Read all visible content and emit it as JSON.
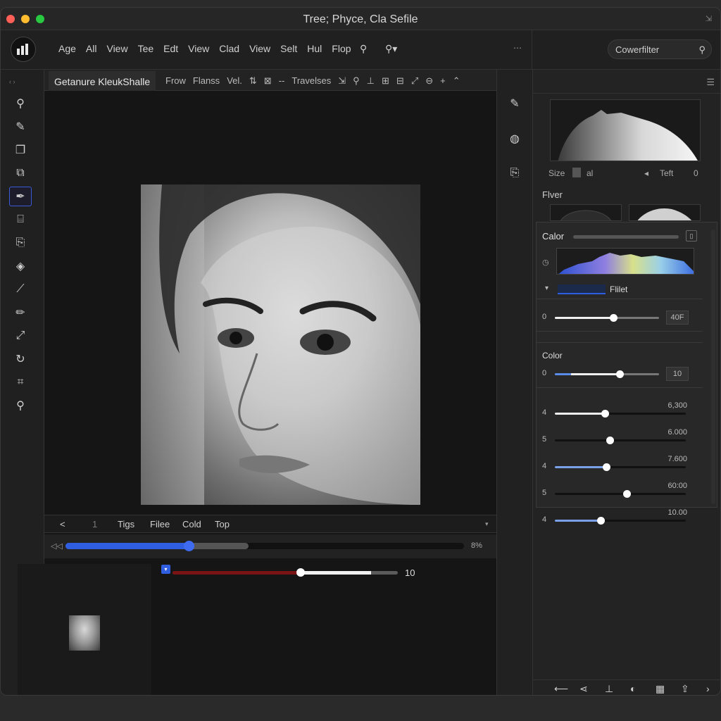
{
  "window": {
    "title": "Tree; Phyce, Cla Sefile"
  },
  "menu": {
    "items": [
      "Age",
      "All",
      "View",
      "Tee",
      "Edt",
      "View",
      "Clad",
      "View",
      "Selt",
      "Hul",
      "Flop"
    ],
    "dots": "⋯",
    "search_label": "Cowerfilter"
  },
  "canvas": {
    "active_tab": "Getanure KleukShalle",
    "tab_items": [
      "Frow",
      "Flanss",
      "Vel.",
      "⇅",
      "⊠",
      "--",
      "Travelses",
      "⇲",
      "⚲",
      "⊥",
      "⊞",
      "⊟",
      "⤢",
      "⊖",
      "+",
      "⌃"
    ]
  },
  "bottom_tabs": {
    "prev": "<",
    "num": "1",
    "items": [
      "Tigs",
      "Filee",
      "Cold",
      "Top"
    ]
  },
  "progress": {
    "value": 0.31,
    "buffer": 0.46,
    "label": "8%"
  },
  "red_slider": {
    "red_fraction": 0.56,
    "knob_fraction": 0.57,
    "white_end": 0.88,
    "value": "10"
  },
  "right_panel": {
    "size_row": {
      "size": "Size",
      "al": "al",
      "teft": "Teft",
      "zero": "0"
    },
    "filter_label": "Flver",
    "color_panel": {
      "title": "Calor",
      "filter_select": "Flilet",
      "rows": [
        {
          "num": "0",
          "value_box": "40F",
          "knob": 0.56,
          "style": "white"
        },
        {
          "section": "Color"
        },
        {
          "num": "0",
          "value_box": "10",
          "knob": 0.62,
          "style": "blue-white"
        },
        {
          "num": "4",
          "value_top": "6,300",
          "knob": 0.38,
          "style": "white"
        },
        {
          "num": "5",
          "value_top": "6.000",
          "knob": 0.42,
          "style": "none"
        },
        {
          "num": "4",
          "value_top": "7.600",
          "knob": 0.39,
          "style": "blue"
        },
        {
          "num": "5",
          "value_top": "60:00",
          "knob": 0.55,
          "style": "none"
        },
        {
          "num": "4",
          "value_top": "10.00",
          "knob": 0.35,
          "style": "blue"
        }
      ]
    }
  },
  "colors": {
    "accent": "#2f5fe0",
    "background": "#1e1e1e",
    "panel": "#232323",
    "red_slider": "#7a1313"
  },
  "icons": {
    "left_tools": [
      "search-icon",
      "brush-icon",
      "layers-icon",
      "crop-icon",
      "pen-icon",
      "text-icon",
      "clone-icon",
      "eraser-icon",
      "eyedropper-icon",
      "pencil-icon",
      "dropper-icon",
      "rotate-icon",
      "transform-icon",
      "zoom-icon"
    ],
    "mid_tools": [
      "edit-icon",
      "globe-icon",
      "clipboard-icon"
    ],
    "footer": [
      "arrow-icon",
      "share-icon",
      "stamp-icon",
      "mask-icon",
      "grid-icon",
      "export-icon",
      "more-icon"
    ]
  }
}
